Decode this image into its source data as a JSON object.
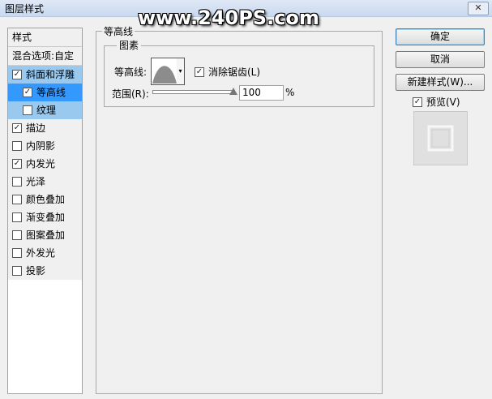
{
  "window": {
    "title": "图层样式",
    "close_glyph": "✕"
  },
  "watermark": "www.240PS.com",
  "left": {
    "heading": "样式",
    "blend": "混合选项:自定",
    "items": [
      {
        "label": "斜面和浮雕",
        "checked": true,
        "selected": true,
        "sub": false
      },
      {
        "label": "等高线",
        "checked": true,
        "selected": true,
        "sub": true,
        "active": true
      },
      {
        "label": "纹理",
        "checked": false,
        "selected": true,
        "sub": true
      },
      {
        "label": "描边",
        "checked": true
      },
      {
        "label": "内阴影",
        "checked": false
      },
      {
        "label": "内发光",
        "checked": true
      },
      {
        "label": "光泽",
        "checked": false
      },
      {
        "label": "颜色叠加",
        "checked": false
      },
      {
        "label": "渐变叠加",
        "checked": false
      },
      {
        "label": "图案叠加",
        "checked": false
      },
      {
        "label": "外发光",
        "checked": false
      },
      {
        "label": "投影",
        "checked": false
      }
    ]
  },
  "main": {
    "group_title": "等高线",
    "sub_group_title": "图素",
    "contour_label": "等高线:",
    "antialias_label": "消除锯齿(L)",
    "antialias_checked": true,
    "range_label": "范围(R):",
    "range_value": "100",
    "range_unit": "%"
  },
  "buttons": {
    "ok": "确定",
    "cancel": "取消",
    "new_style": "新建样式(W)...",
    "preview_label": "预览(V)",
    "preview_checked": true
  },
  "icons": {
    "check": "✓",
    "dropdown": "▾"
  }
}
